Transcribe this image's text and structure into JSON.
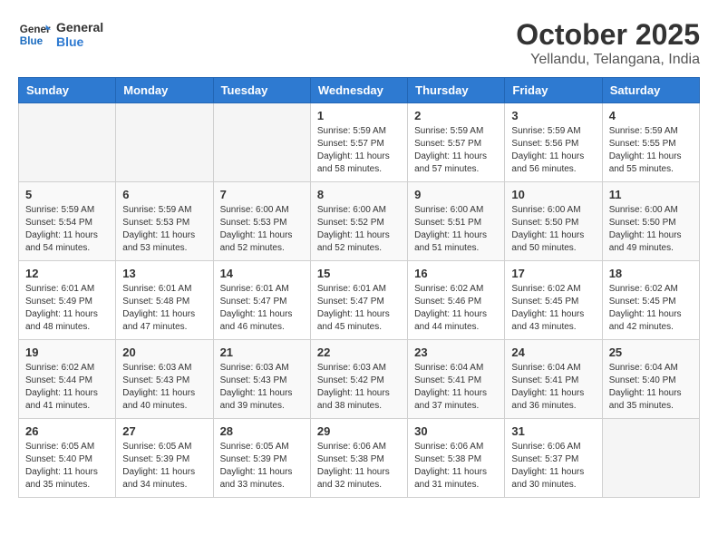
{
  "header": {
    "logo_line1": "General",
    "logo_line2": "Blue",
    "title": "October 2025",
    "subtitle": "Yellandu, Telangana, India"
  },
  "weekdays": [
    "Sunday",
    "Monday",
    "Tuesday",
    "Wednesday",
    "Thursday",
    "Friday",
    "Saturday"
  ],
  "weeks": [
    [
      {
        "day": "",
        "info": ""
      },
      {
        "day": "",
        "info": ""
      },
      {
        "day": "",
        "info": ""
      },
      {
        "day": "1",
        "info": "Sunrise: 5:59 AM\nSunset: 5:57 PM\nDaylight: 11 hours\nand 58 minutes."
      },
      {
        "day": "2",
        "info": "Sunrise: 5:59 AM\nSunset: 5:57 PM\nDaylight: 11 hours\nand 57 minutes."
      },
      {
        "day": "3",
        "info": "Sunrise: 5:59 AM\nSunset: 5:56 PM\nDaylight: 11 hours\nand 56 minutes."
      },
      {
        "day": "4",
        "info": "Sunrise: 5:59 AM\nSunset: 5:55 PM\nDaylight: 11 hours\nand 55 minutes."
      }
    ],
    [
      {
        "day": "5",
        "info": "Sunrise: 5:59 AM\nSunset: 5:54 PM\nDaylight: 11 hours\nand 54 minutes."
      },
      {
        "day": "6",
        "info": "Sunrise: 5:59 AM\nSunset: 5:53 PM\nDaylight: 11 hours\nand 53 minutes."
      },
      {
        "day": "7",
        "info": "Sunrise: 6:00 AM\nSunset: 5:53 PM\nDaylight: 11 hours\nand 52 minutes."
      },
      {
        "day": "8",
        "info": "Sunrise: 6:00 AM\nSunset: 5:52 PM\nDaylight: 11 hours\nand 52 minutes."
      },
      {
        "day": "9",
        "info": "Sunrise: 6:00 AM\nSunset: 5:51 PM\nDaylight: 11 hours\nand 51 minutes."
      },
      {
        "day": "10",
        "info": "Sunrise: 6:00 AM\nSunset: 5:50 PM\nDaylight: 11 hours\nand 50 minutes."
      },
      {
        "day": "11",
        "info": "Sunrise: 6:00 AM\nSunset: 5:50 PM\nDaylight: 11 hours\nand 49 minutes."
      }
    ],
    [
      {
        "day": "12",
        "info": "Sunrise: 6:01 AM\nSunset: 5:49 PM\nDaylight: 11 hours\nand 48 minutes."
      },
      {
        "day": "13",
        "info": "Sunrise: 6:01 AM\nSunset: 5:48 PM\nDaylight: 11 hours\nand 47 minutes."
      },
      {
        "day": "14",
        "info": "Sunrise: 6:01 AM\nSunset: 5:47 PM\nDaylight: 11 hours\nand 46 minutes."
      },
      {
        "day": "15",
        "info": "Sunrise: 6:01 AM\nSunset: 5:47 PM\nDaylight: 11 hours\nand 45 minutes."
      },
      {
        "day": "16",
        "info": "Sunrise: 6:02 AM\nSunset: 5:46 PM\nDaylight: 11 hours\nand 44 minutes."
      },
      {
        "day": "17",
        "info": "Sunrise: 6:02 AM\nSunset: 5:45 PM\nDaylight: 11 hours\nand 43 minutes."
      },
      {
        "day": "18",
        "info": "Sunrise: 6:02 AM\nSunset: 5:45 PM\nDaylight: 11 hours\nand 42 minutes."
      }
    ],
    [
      {
        "day": "19",
        "info": "Sunrise: 6:02 AM\nSunset: 5:44 PM\nDaylight: 11 hours\nand 41 minutes."
      },
      {
        "day": "20",
        "info": "Sunrise: 6:03 AM\nSunset: 5:43 PM\nDaylight: 11 hours\nand 40 minutes."
      },
      {
        "day": "21",
        "info": "Sunrise: 6:03 AM\nSunset: 5:43 PM\nDaylight: 11 hours\nand 39 minutes."
      },
      {
        "day": "22",
        "info": "Sunrise: 6:03 AM\nSunset: 5:42 PM\nDaylight: 11 hours\nand 38 minutes."
      },
      {
        "day": "23",
        "info": "Sunrise: 6:04 AM\nSunset: 5:41 PM\nDaylight: 11 hours\nand 37 minutes."
      },
      {
        "day": "24",
        "info": "Sunrise: 6:04 AM\nSunset: 5:41 PM\nDaylight: 11 hours\nand 36 minutes."
      },
      {
        "day": "25",
        "info": "Sunrise: 6:04 AM\nSunset: 5:40 PM\nDaylight: 11 hours\nand 35 minutes."
      }
    ],
    [
      {
        "day": "26",
        "info": "Sunrise: 6:05 AM\nSunset: 5:40 PM\nDaylight: 11 hours\nand 35 minutes."
      },
      {
        "day": "27",
        "info": "Sunrise: 6:05 AM\nSunset: 5:39 PM\nDaylight: 11 hours\nand 34 minutes."
      },
      {
        "day": "28",
        "info": "Sunrise: 6:05 AM\nSunset: 5:39 PM\nDaylight: 11 hours\nand 33 minutes."
      },
      {
        "day": "29",
        "info": "Sunrise: 6:06 AM\nSunset: 5:38 PM\nDaylight: 11 hours\nand 32 minutes."
      },
      {
        "day": "30",
        "info": "Sunrise: 6:06 AM\nSunset: 5:38 PM\nDaylight: 11 hours\nand 31 minutes."
      },
      {
        "day": "31",
        "info": "Sunrise: 6:06 AM\nSunset: 5:37 PM\nDaylight: 11 hours\nand 30 minutes."
      },
      {
        "day": "",
        "info": ""
      }
    ]
  ]
}
